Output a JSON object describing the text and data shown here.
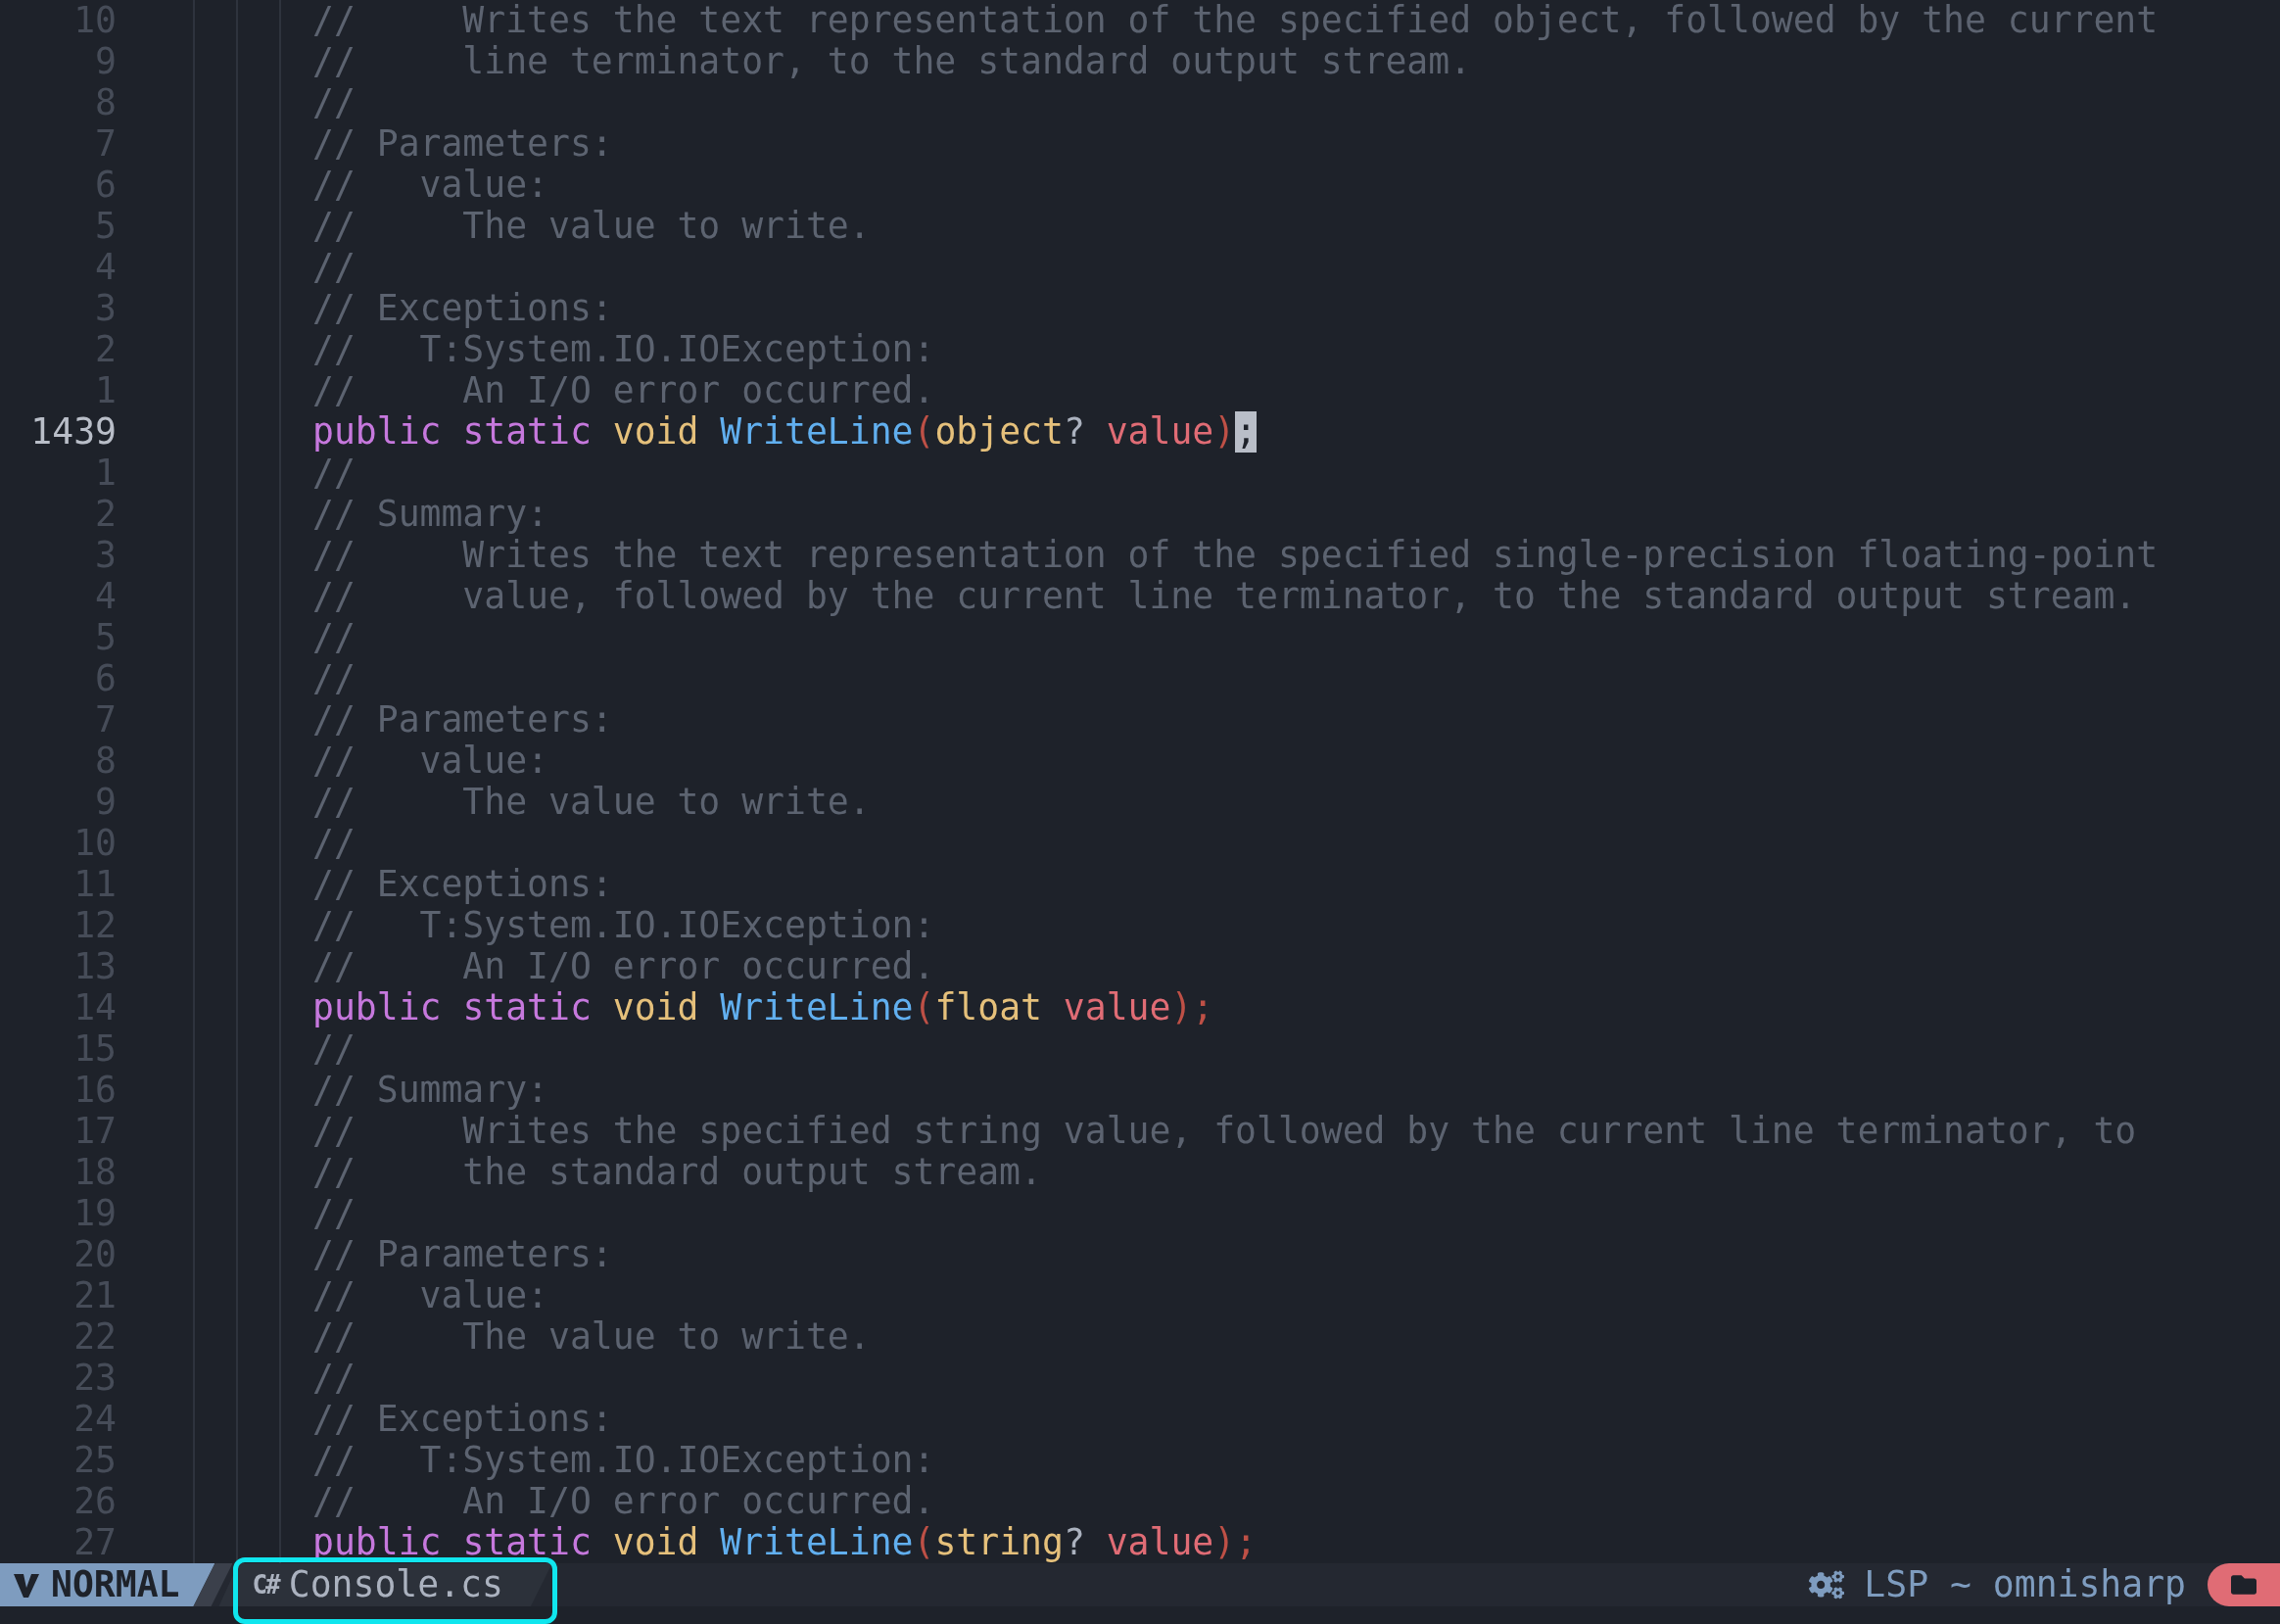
{
  "editor": {
    "lines": [
      {
        "number": "10",
        "current": false,
        "tokens": [
          {
            "kind": "comment",
            "text": "//     Writes the text representation of the specified object, followed by the current"
          }
        ]
      },
      {
        "number": "9",
        "current": false,
        "tokens": [
          {
            "kind": "comment",
            "text": "//     line terminator, to the standard output stream."
          }
        ]
      },
      {
        "number": "8",
        "current": false,
        "tokens": [
          {
            "kind": "comment",
            "text": "//"
          }
        ]
      },
      {
        "number": "7",
        "current": false,
        "tokens": [
          {
            "kind": "comment",
            "text": "// Parameters:"
          }
        ]
      },
      {
        "number": "6",
        "current": false,
        "tokens": [
          {
            "kind": "comment",
            "text": "//   value:"
          }
        ]
      },
      {
        "number": "5",
        "current": false,
        "tokens": [
          {
            "kind": "comment",
            "text": "//     The value to write."
          }
        ]
      },
      {
        "number": "4",
        "current": false,
        "tokens": [
          {
            "kind": "comment",
            "text": "//"
          }
        ]
      },
      {
        "number": "3",
        "current": false,
        "tokens": [
          {
            "kind": "comment",
            "text": "// Exceptions:"
          }
        ]
      },
      {
        "number": "2",
        "current": false,
        "tokens": [
          {
            "kind": "comment",
            "text": "//   T:System.IO.IOException:"
          }
        ]
      },
      {
        "number": "1",
        "current": false,
        "tokens": [
          {
            "kind": "comment",
            "text": "//     An I/O error occurred."
          }
        ]
      },
      {
        "number": "1439",
        "current": true,
        "tokens": [
          {
            "kind": "keyword",
            "text": "public"
          },
          {
            "kind": "keyword",
            "text": " static"
          },
          {
            "kind": "type",
            "text": " void"
          },
          {
            "kind": "function",
            "text": " WriteLine"
          },
          {
            "kind": "paren",
            "text": "("
          },
          {
            "kind": "type",
            "text": "object"
          },
          {
            "kind": "plain",
            "text": "? "
          },
          {
            "kind": "param",
            "text": "value"
          },
          {
            "kind": "paren",
            "text": ")"
          },
          {
            "kind": "plain",
            "text": ";",
            "cursor": true
          }
        ]
      },
      {
        "number": "1",
        "current": false,
        "tokens": [
          {
            "kind": "comment",
            "text": "//"
          }
        ]
      },
      {
        "number": "2",
        "current": false,
        "tokens": [
          {
            "kind": "comment",
            "text": "// Summary:"
          }
        ]
      },
      {
        "number": "3",
        "current": false,
        "tokens": [
          {
            "kind": "comment",
            "text": "//     Writes the text representation of the specified single-precision floating-point"
          }
        ]
      },
      {
        "number": "4",
        "current": false,
        "tokens": [
          {
            "kind": "comment",
            "text": "//     value, followed by the current line terminator, to the standard output stream."
          }
        ]
      },
      {
        "number": "5",
        "current": false,
        "tokens": [
          {
            "kind": "comment",
            "text": "//"
          }
        ]
      },
      {
        "number": "6",
        "current": false,
        "tokens": [
          {
            "kind": "comment",
            "text": "//"
          }
        ]
      },
      {
        "number": "7",
        "current": false,
        "tokens": [
          {
            "kind": "comment",
            "text": "// Parameters:"
          }
        ]
      },
      {
        "number": "8",
        "current": false,
        "tokens": [
          {
            "kind": "comment",
            "text": "//   value:"
          }
        ]
      },
      {
        "number": "9",
        "current": false,
        "tokens": [
          {
            "kind": "comment",
            "text": "//     The value to write."
          }
        ]
      },
      {
        "number": "10",
        "current": false,
        "tokens": [
          {
            "kind": "comment",
            "text": "//"
          }
        ]
      },
      {
        "number": "11",
        "current": false,
        "tokens": [
          {
            "kind": "comment",
            "text": "// Exceptions:"
          }
        ]
      },
      {
        "number": "12",
        "current": false,
        "tokens": [
          {
            "kind": "comment",
            "text": "//   T:System.IO.IOException:"
          }
        ]
      },
      {
        "number": "13",
        "current": false,
        "tokens": [
          {
            "kind": "comment",
            "text": "//     An I/O error occurred."
          }
        ]
      },
      {
        "number": "14",
        "current": false,
        "tokens": [
          {
            "kind": "keyword",
            "text": "public"
          },
          {
            "kind": "keyword",
            "text": " static"
          },
          {
            "kind": "type",
            "text": " void"
          },
          {
            "kind": "function",
            "text": " WriteLine"
          },
          {
            "kind": "paren",
            "text": "("
          },
          {
            "kind": "type",
            "text": "float"
          },
          {
            "kind": "param",
            "text": " value"
          },
          {
            "kind": "paren",
            "text": ")"
          },
          {
            "kind": "paren",
            "text": ";"
          }
        ]
      },
      {
        "number": "15",
        "current": false,
        "tokens": [
          {
            "kind": "comment",
            "text": "//"
          }
        ]
      },
      {
        "number": "16",
        "current": false,
        "tokens": [
          {
            "kind": "comment",
            "text": "// Summary:"
          }
        ]
      },
      {
        "number": "17",
        "current": false,
        "tokens": [
          {
            "kind": "comment",
            "text": "//     Writes the specified string value, followed by the current line terminator, to"
          }
        ]
      },
      {
        "number": "18",
        "current": false,
        "tokens": [
          {
            "kind": "comment",
            "text": "//     the standard output stream."
          }
        ]
      },
      {
        "number": "19",
        "current": false,
        "tokens": [
          {
            "kind": "comment",
            "text": "//"
          }
        ]
      },
      {
        "number": "20",
        "current": false,
        "tokens": [
          {
            "kind": "comment",
            "text": "// Parameters:"
          }
        ]
      },
      {
        "number": "21",
        "current": false,
        "tokens": [
          {
            "kind": "comment",
            "text": "//   value:"
          }
        ]
      },
      {
        "number": "22",
        "current": false,
        "tokens": [
          {
            "kind": "comment",
            "text": "//     The value to write."
          }
        ]
      },
      {
        "number": "23",
        "current": false,
        "tokens": [
          {
            "kind": "comment",
            "text": "//"
          }
        ]
      },
      {
        "number": "24",
        "current": false,
        "tokens": [
          {
            "kind": "comment",
            "text": "// Exceptions:"
          }
        ]
      },
      {
        "number": "25",
        "current": false,
        "tokens": [
          {
            "kind": "comment",
            "text": "//   T:System.IO.IOException:"
          }
        ]
      },
      {
        "number": "26",
        "current": false,
        "tokens": [
          {
            "kind": "comment",
            "text": "//     An I/O error occurred."
          }
        ]
      },
      {
        "number": "27",
        "current": false,
        "tokens": [
          {
            "kind": "keyword",
            "text": "public"
          },
          {
            "kind": "keyword",
            "text": " static"
          },
          {
            "kind": "type",
            "text": " void"
          },
          {
            "kind": "function",
            "text": " WriteLine"
          },
          {
            "kind": "paren",
            "text": "("
          },
          {
            "kind": "type",
            "text": "string"
          },
          {
            "kind": "plain",
            "text": "? "
          },
          {
            "kind": "param",
            "text": "value"
          },
          {
            "kind": "paren",
            "text": ")"
          },
          {
            "kind": "paren",
            "text": ";"
          }
        ]
      }
    ]
  },
  "status_bar": {
    "mode": "NORMAL",
    "file_icon": "C#",
    "file_name": "Console.cs",
    "file_highlighted": true,
    "lsp": "LSP ~ omnisharp"
  }
}
